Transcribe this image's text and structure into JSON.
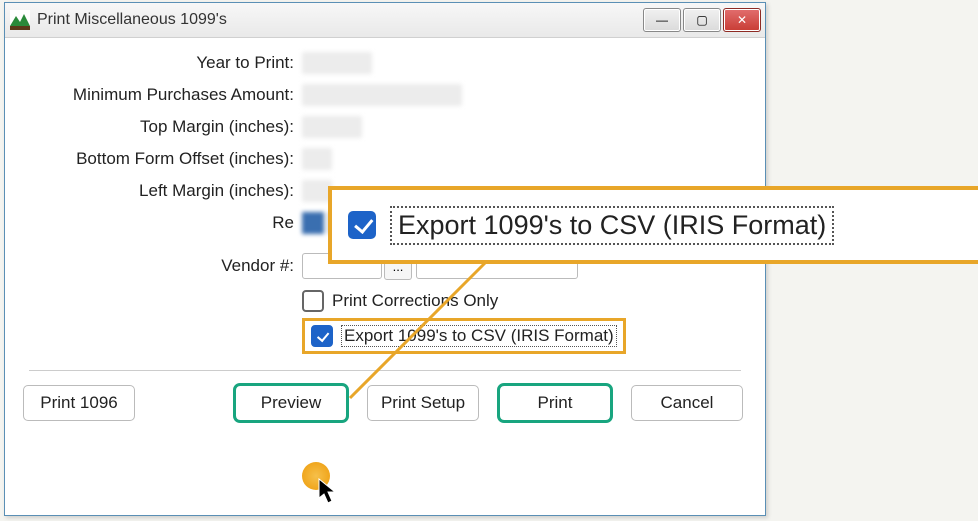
{
  "window": {
    "title": "Print Miscellaneous 1099's"
  },
  "labels": {
    "year": "Year to Print:",
    "minpurch": "Minimum Purchases Amount:",
    "topmargin": "Top Margin (inches):",
    "bottomoffset": "Bottom Form Offset (inches):",
    "leftmargin": "Left Margin (inches):",
    "rej_prefix": "Re",
    "vendor": "Vendor #:"
  },
  "checkboxes": {
    "corrections": "Print Corrections Only",
    "export_csv": "Export 1099's to CSV (IRIS Format)"
  },
  "buttons": {
    "print1096": "Print 1096",
    "preview": "Preview",
    "printsetup": "Print Setup",
    "print": "Print",
    "cancel": "Cancel",
    "ellipsis": "...",
    "minimize": "—",
    "maximize": "▢",
    "close": "✕"
  },
  "callout": {
    "label": "Export 1099's to CSV (IRIS Format)"
  }
}
